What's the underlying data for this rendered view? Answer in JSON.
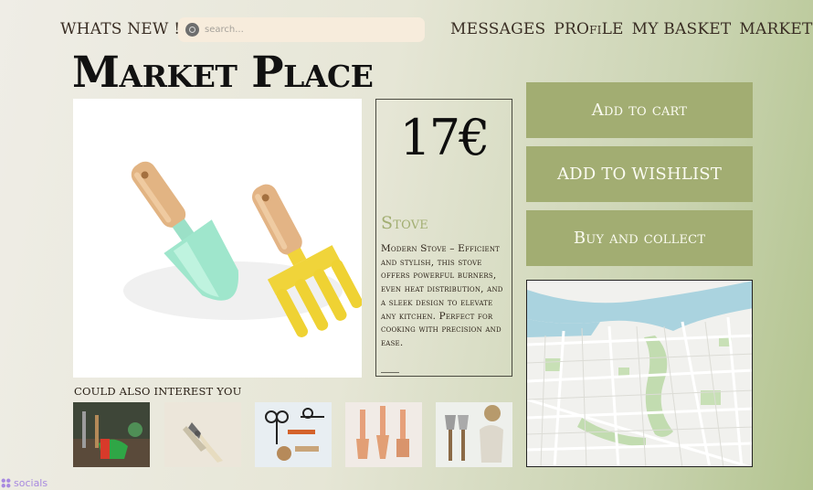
{
  "header": {
    "whats_new": "WHATS NEW !",
    "search_placeholder": "search...",
    "nav": [
      "MESSAGES",
      "PROfiLE",
      "MY BASKET",
      "MARKET"
    ]
  },
  "page_title": "Market Place",
  "product": {
    "price": "17€",
    "name": "Stove",
    "description": "Modern Stove – Efficient and stylish, this stove offers powerful burners, even heat distribution, and a sleek design to elevate any kitchen. Perfect for cooking with precision and ease."
  },
  "actions": {
    "add_to_cart": "Add to cart",
    "add_to_wishlist": "ADD TO WISHLIST",
    "buy_and_collect": "Buy and collect"
  },
  "related": {
    "heading": "COULD ALSO INTEREST YOU"
  },
  "footer": {
    "socials": "socials"
  },
  "icons": [
    "search-icon",
    "socials-icon"
  ],
  "colors": {
    "accent": "#a2ad72",
    "product_name": "#a2ae72",
    "search_bg": "#f7ecdc",
    "socials": "#a88ae0"
  }
}
